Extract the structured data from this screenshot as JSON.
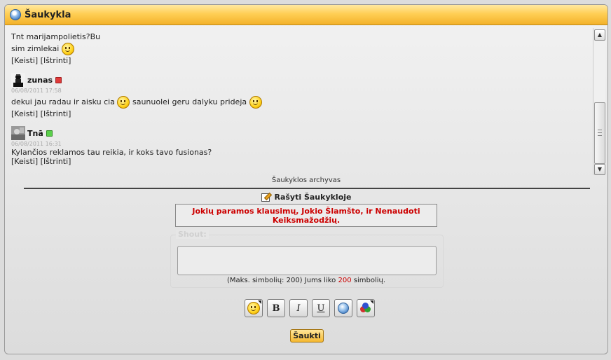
{
  "window": {
    "title": "Šaukykla"
  },
  "messages": [
    {
      "lines": [
        "Tnt marijampolietis?Bu",
        "sim zimlekai"
      ],
      "actions": "[Keisti] [Ištrinti]"
    },
    {
      "user": "zunas",
      "status": "offline",
      "time": "06/08/2011 17:58",
      "text_before": "dekui jau radau ir aisku cia",
      "text_middle": "saunuolei geru dalyku prideja",
      "actions": "[Keisti] [Ištrinti]"
    },
    {
      "user": "Tnā",
      "status": "online",
      "time": "06/08/2011 16:31",
      "text": "Kylančios reklamos tau reikia, ir koks tavo fusionas?",
      "actions": "[Keisti] [Ištrinti]"
    }
  ],
  "archive_link": "Šaukyklos archyvas",
  "write_heading": "Rašyti Šaukykloje",
  "rules_notice": "Jokių paramos klausimų, Jokio Šlamšto, ir Nenaudoti Keiksmažodžių.",
  "form": {
    "legend": "Shout:",
    "shout_value": "",
    "charcount_prefix": "(Maks. simbolių: 200) Jums liko",
    "charcount_remaining": "200",
    "charcount_suffix": "simbolių.",
    "submit_label": "Šaukti"
  },
  "toolbar": {
    "bold": "B",
    "italic": "I",
    "underline": "U",
    "icons": [
      "smiley-icon",
      "bold-icon",
      "italic-icon",
      "underline-icon",
      "url-icon",
      "color-icon"
    ]
  },
  "colors": {
    "title_bar": "#ffcf55",
    "notice_text": "#cc0000",
    "online": "#5ad04a",
    "offline": "#e03a3a"
  }
}
